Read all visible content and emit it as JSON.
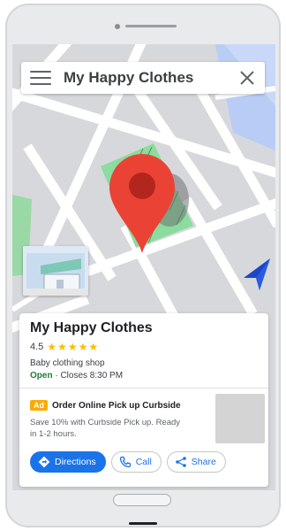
{
  "search": {
    "query": "My Happy Clothes"
  },
  "place": {
    "name": "My Happy Clothes",
    "rating": "4.5",
    "stars": "★★★★★",
    "category": "Baby clothing shop",
    "status": "Open",
    "hours": " · Closes 8:30 PM"
  },
  "ad": {
    "badge": "Ad",
    "title": "Order Online Pick up Curbside",
    "description": "Save 10% with Curbside Pick up. Ready in 1-2 hours."
  },
  "actions": {
    "directions": "Directions",
    "call": "Call",
    "share": "Share"
  },
  "icons": {
    "menu": "menu-icon",
    "close": "close-icon",
    "pin": "map-pin-icon",
    "navigation": "navigation-arrow-icon",
    "directions": "directions-icon",
    "call": "phone-icon",
    "share": "share-icon"
  },
  "colors": {
    "accent": "#1a73e8",
    "pin": "#ea4335",
    "open": "#188038",
    "star": "#fbbc04",
    "ad_badge": "#f9ab00",
    "map_road": "#ffffff",
    "map_block": "#d7d8db",
    "map_park": "#8bdc9e",
    "map_water": "#b9ccf5"
  }
}
